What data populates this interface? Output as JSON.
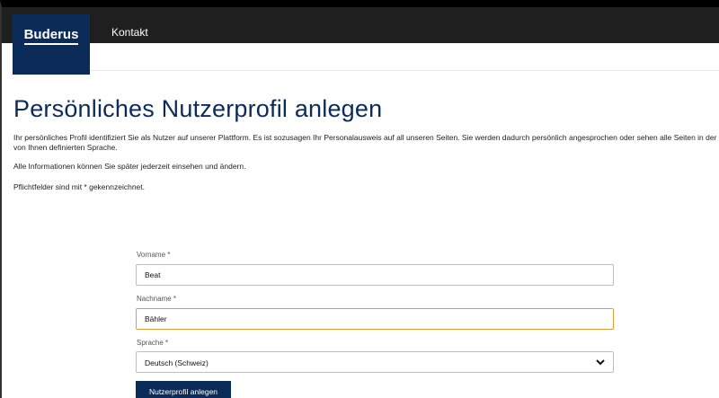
{
  "header": {
    "logo": "Buderus",
    "nav_link": "Kontakt"
  },
  "main": {
    "title": "Persönliches Nutzerprofil anlegen",
    "intro": "Ihr persönliches Profil identifiziert Sie als Nutzer auf unserer Plattform. Es ist sozusagen Ihr Personalausweis auf all unseren Seiten. Sie werden dadurch persönlich angesprochen oder sehen alle Seiten in der von Ihnen definierten Sprache.",
    "info_note": "Alle Informationen können Sie später jederzeit einsehen und ändern.",
    "required_note": "Pflichtfelder sind mit * gekennzeichnet."
  },
  "form": {
    "firstname": {
      "label": "Vorname *",
      "value": "Beat"
    },
    "lastname": {
      "label": "Nachname *",
      "value": "Bähler"
    },
    "language": {
      "label": "Sprache *",
      "selected": "Deutsch (Schweiz)"
    },
    "submit_label": "Nutzerprofil anlegen"
  },
  "colors": {
    "brand": "#0b2b59",
    "topbar": "#1f1f1f",
    "focus_border": "#e09a3a"
  },
  "icons": {
    "select_arrow": "chevron-down-icon"
  }
}
